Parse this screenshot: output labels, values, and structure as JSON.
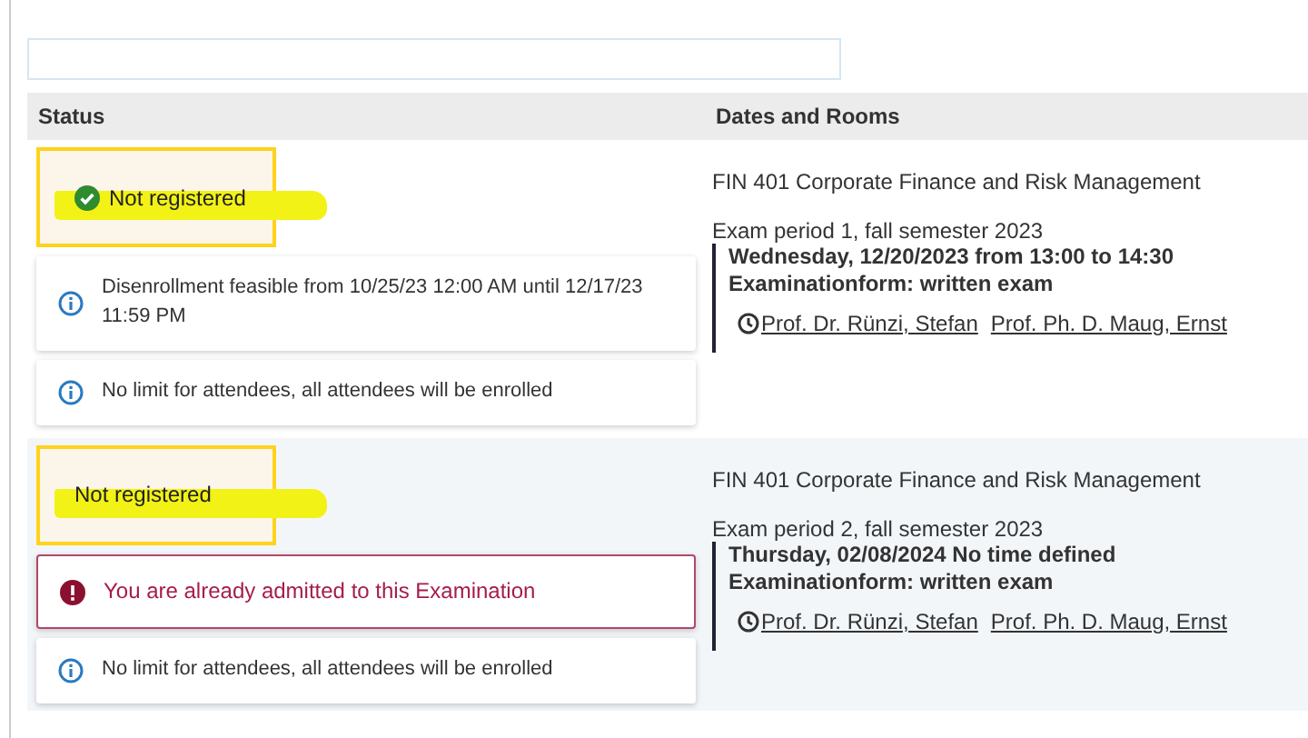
{
  "table": {
    "columns": [
      "Status",
      "Dates and Rooms"
    ],
    "rows": [
      {
        "status": {
          "label": "Not registered",
          "kind": "confirmed",
          "highlighted": true
        },
        "messages": [
          {
            "kind": "info",
            "text": "Disenrollment feasible from 10/25/23 12:00 AM until 12/17/23 11:59 PM"
          },
          {
            "kind": "info",
            "text": "No limit for attendees, all attendees will be enrolled"
          }
        ],
        "course": "FIN 401 Corporate Finance and Risk Management",
        "period": "Exam period 1, fall semester 2023",
        "date": "Wednesday, 12/20/2023 from 13:00 to 14:30",
        "form": "Examinationform: written exam",
        "lecturers": [
          "Prof. Dr. Rünzi, Stefan",
          "Prof. Ph. D. Maug, Ernst"
        ]
      },
      {
        "status": {
          "label": "Not registered",
          "kind": "plain",
          "highlighted": true
        },
        "messages": [
          {
            "kind": "error",
            "text": "You are already admitted to this Examination"
          },
          {
            "kind": "info",
            "text": "No limit for attendees, all attendees will be enrolled"
          }
        ],
        "course": "FIN 401 Corporate Finance and Risk Management",
        "period": "Exam period 2, fall semester 2023",
        "date": "Thursday, 02/08/2024 No time defined",
        "form": "Examinationform: written exam",
        "lecturers": [
          "Prof. Dr. Rünzi, Stefan",
          "Prof. Ph. D. Maug, Ernst"
        ]
      }
    ]
  }
}
